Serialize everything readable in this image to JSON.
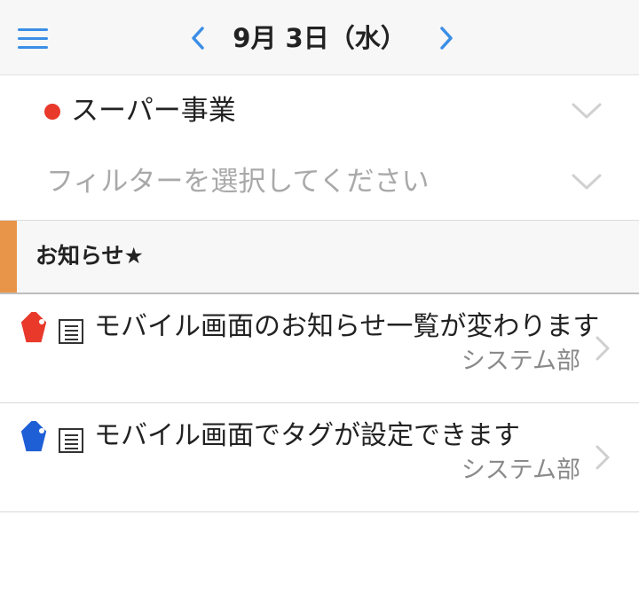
{
  "header": {
    "date": "9月 3日（水）",
    "menu_icon": "hamburger-menu-icon",
    "prev_icon": "chevron-left-icon",
    "next_icon": "chevron-right-icon",
    "accent_color": "#3a8ee6"
  },
  "category": {
    "label": "スーパー事業",
    "dot_color": "#e8392b"
  },
  "filter": {
    "placeholder": "フィルターを選択してください"
  },
  "section": {
    "title": "お知らせ★",
    "bar_color": "#e8954a"
  },
  "news": [
    {
      "title": "モバイル画面のお知らせ一覧が変わります",
      "department": "システム部",
      "tag_color": "#e8392b",
      "icon": "document-icon"
    },
    {
      "title": "モバイル画面でタグが設定できます",
      "department": "システム部",
      "tag_color": "#1f5fd6",
      "icon": "document-icon"
    }
  ]
}
